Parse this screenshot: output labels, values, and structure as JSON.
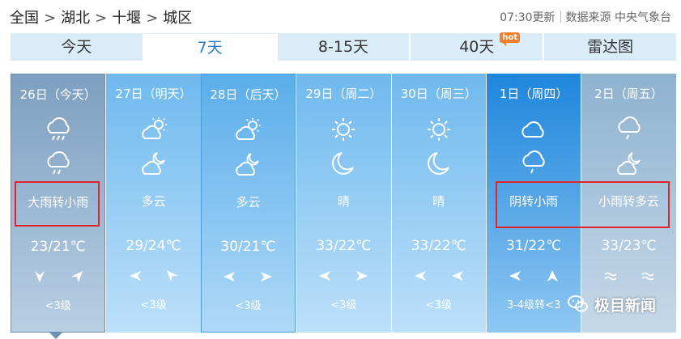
{
  "breadcrumb": [
    "全国",
    "湖北",
    "十堰",
    "城区"
  ],
  "breadcrumb_sep": ">",
  "update_time": "07:30更新",
  "data_source": "数据来源 中央气象台",
  "tabs": [
    {
      "label": "今天"
    },
    {
      "label": "7天"
    },
    {
      "label": "8-15天"
    },
    {
      "label": "40天",
      "badge": "hot"
    },
    {
      "label": "雷达图"
    }
  ],
  "active_tab": "7天",
  "days": [
    {
      "date": "26日（今天）",
      "icon_day": "rain-cloud-icon",
      "icon_night": "rain-cloud-icon",
      "weather": "大雨转小雨",
      "temp": "23/21℃",
      "wind_day": "north",
      "wind_night": "southwest",
      "wind_level": "<3级"
    },
    {
      "date": "27日（明天）",
      "icon_day": "partly-cloudy-day-icon",
      "icon_night": "partly-cloudy-night-icon",
      "weather": "多云",
      "temp": "29/24℃",
      "wind_day": "east",
      "wind_night": "southwest",
      "wind_level": "<3级"
    },
    {
      "date": "28日（后天）",
      "icon_day": "partly-cloudy-day-icon",
      "icon_night": "partly-cloudy-night-icon",
      "weather": "多云",
      "temp": "30/21℃",
      "wind_day": "east",
      "wind_night": "west",
      "wind_level": "<3级"
    },
    {
      "date": "29日（周二）",
      "icon_day": "sun-icon",
      "icon_night": "moon-icon",
      "weather": "晴",
      "temp": "33/22℃",
      "wind_day": "east",
      "wind_night": "west",
      "wind_level": "<3级"
    },
    {
      "date": "30日（周三）",
      "icon_day": "sun-icon",
      "icon_night": "moon-icon",
      "weather": "晴",
      "temp": "33/22℃",
      "wind_day": "east",
      "wind_night": "east",
      "wind_level": "<3级"
    },
    {
      "date": "1日（周四）",
      "icon_day": "cloudy-icon",
      "icon_night": "rain-cloud-icon",
      "weather": "阴转小雨",
      "temp": "31/22℃",
      "wind_day": "east",
      "wind_night": "northeast",
      "wind_level": "3-4级转<3"
    },
    {
      "date": "2日（周五）",
      "icon_day": "rain-cloud-icon",
      "icon_night": "partly-cloudy-night-icon",
      "weather": "小雨转多云",
      "temp": "33/23℃",
      "wind_day": "variable",
      "wind_night": "variable",
      "wind_level": ""
    }
  ],
  "watermark": "极目新闻",
  "colors": {
    "highlight": "#e0252a",
    "active_tab_text": "#2a7cc7",
    "hot_badge": "#f37f2a"
  }
}
